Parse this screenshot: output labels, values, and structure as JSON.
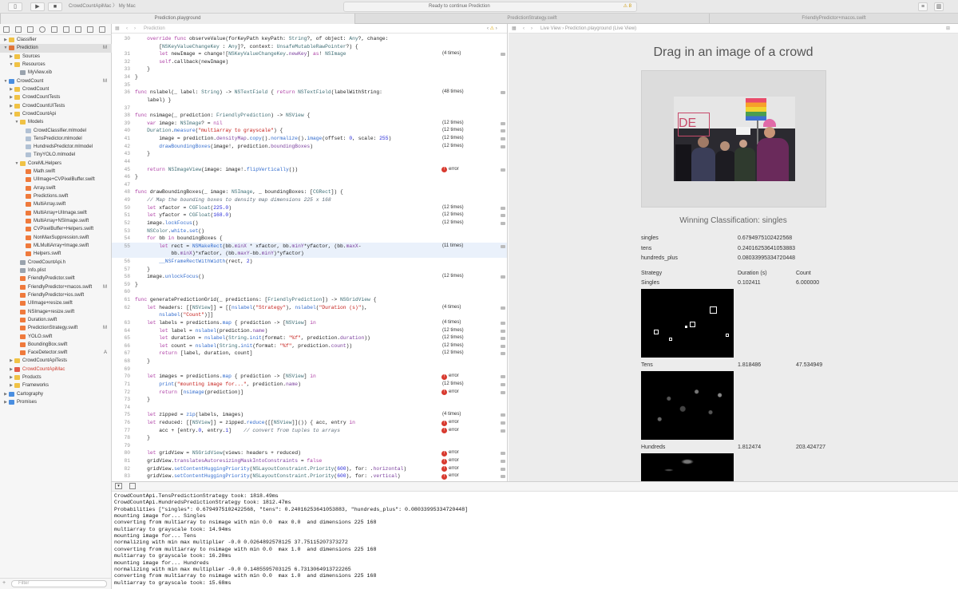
{
  "toolbar": {
    "scheme": "CrowdCountApiMac",
    "destination": "My Mac",
    "status": "Ready to continue Prediction",
    "warnings": "8"
  },
  "tabs": [
    "Prediction.playground",
    "PredictionStrategy.swift",
    "FriendlyPredictor+macos.swift"
  ],
  "navigator": {
    "filter_placeholder": "Filter",
    "items": [
      {
        "label": "Classifier",
        "depth": 0,
        "kind": "folder",
        "open": false,
        "badge": ""
      },
      {
        "label": "Prediction",
        "depth": 0,
        "kind": "playground",
        "open": true,
        "badge": "M",
        "selected": true
      },
      {
        "label": "Sources",
        "depth": 1,
        "kind": "folder",
        "open": false,
        "badge": ""
      },
      {
        "label": "Resources",
        "depth": 1,
        "kind": "folder",
        "open": true,
        "badge": ""
      },
      {
        "label": "MyView.xib",
        "depth": 2,
        "kind": "file",
        "open": null,
        "badge": ""
      },
      {
        "label": "CrowdCount",
        "depth": 0,
        "kind": "project",
        "open": true,
        "badge": "M"
      },
      {
        "label": "CrowdCount",
        "depth": 1,
        "kind": "folder",
        "open": false,
        "badge": ""
      },
      {
        "label": "CrowdCountTests",
        "depth": 1,
        "kind": "folder",
        "open": false,
        "badge": ""
      },
      {
        "label": "CrowdCountUITests",
        "depth": 1,
        "kind": "folder",
        "open": false,
        "badge": ""
      },
      {
        "label": "CrowdCountApi",
        "depth": 1,
        "kind": "folder",
        "open": true,
        "badge": ""
      },
      {
        "label": "Models",
        "depth": 2,
        "kind": "folder",
        "open": true,
        "badge": ""
      },
      {
        "label": "CrowdClassifier.mlmodel",
        "depth": 3,
        "kind": "model",
        "open": null,
        "badge": ""
      },
      {
        "label": "TensPredictor.mlmodel",
        "depth": 3,
        "kind": "model",
        "open": null,
        "badge": ""
      },
      {
        "label": "HundredsPredictor.mlmodel",
        "depth": 3,
        "kind": "model",
        "open": null,
        "badge": ""
      },
      {
        "label": "TinyYOLO.mlmodel",
        "depth": 3,
        "kind": "model",
        "open": null,
        "badge": ""
      },
      {
        "label": "CoreMLHelpers",
        "depth": 2,
        "kind": "folder",
        "open": true,
        "badge": ""
      },
      {
        "label": "Math.swift",
        "depth": 3,
        "kind": "swift",
        "open": null,
        "badge": ""
      },
      {
        "label": "UIImage+CVPixelBuffer.swift",
        "depth": 3,
        "kind": "swift",
        "open": null,
        "badge": ""
      },
      {
        "label": "Array.swift",
        "depth": 3,
        "kind": "swift",
        "open": null,
        "badge": ""
      },
      {
        "label": "Predictions.swift",
        "depth": 3,
        "kind": "swift",
        "open": null,
        "badge": ""
      },
      {
        "label": "MultiArray.swift",
        "depth": 3,
        "kind": "swift",
        "open": null,
        "badge": ""
      },
      {
        "label": "MultiArray+UIImage.swift",
        "depth": 3,
        "kind": "swift",
        "open": null,
        "badge": ""
      },
      {
        "label": "MultiArray+NSImage.swift",
        "depth": 3,
        "kind": "swift",
        "open": null,
        "badge": ""
      },
      {
        "label": "CVPixelBuffer+Helpers.swift",
        "depth": 3,
        "kind": "swift",
        "open": null,
        "badge": ""
      },
      {
        "label": "NonMaxSuppression.swift",
        "depth": 3,
        "kind": "swift",
        "open": null,
        "badge": ""
      },
      {
        "label": "MLMultiArray+Image.swift",
        "depth": 3,
        "kind": "swift",
        "open": null,
        "badge": ""
      },
      {
        "label": "Helpers.swift",
        "depth": 3,
        "kind": "swift",
        "open": null,
        "badge": ""
      },
      {
        "label": "CrowdCountApi.h",
        "depth": 2,
        "kind": "header",
        "open": null,
        "badge": ""
      },
      {
        "label": "Info.plist",
        "depth": 2,
        "kind": "plist",
        "open": null,
        "badge": ""
      },
      {
        "label": "FriendlyPredictor.swift",
        "depth": 2,
        "kind": "swift",
        "open": null,
        "badge": ""
      },
      {
        "label": "FriendlyPredictor+macos.swift",
        "depth": 2,
        "kind": "swift",
        "open": null,
        "badge": "M"
      },
      {
        "label": "FriendlyPredictor+ios.swift",
        "depth": 2,
        "kind": "swift",
        "open": null,
        "badge": ""
      },
      {
        "label": "UIImage+resize.swift",
        "depth": 2,
        "kind": "swift",
        "open": null,
        "badge": ""
      },
      {
        "label": "NSImage+resize.swift",
        "depth": 2,
        "kind": "swift",
        "open": null,
        "badge": ""
      },
      {
        "label": "Duration.swift",
        "depth": 2,
        "kind": "swift",
        "open": null,
        "badge": ""
      },
      {
        "label": "PredictionStrategy.swift",
        "depth": 2,
        "kind": "swift",
        "open": null,
        "badge": "M"
      },
      {
        "label": "YOLO.swift",
        "depth": 2,
        "kind": "swift",
        "open": null,
        "badge": ""
      },
      {
        "label": "BoundingBox.swift",
        "depth": 2,
        "kind": "swift",
        "open": null,
        "badge": ""
      },
      {
        "label": "FaceDetector.swift",
        "depth": 2,
        "kind": "swift",
        "open": null,
        "badge": "A"
      },
      {
        "label": "CrowdCountApiTests",
        "depth": 1,
        "kind": "folder",
        "open": false,
        "badge": ""
      },
      {
        "label": "CrowdCountApiMac",
        "depth": 1,
        "kind": "folder-red",
        "open": false,
        "badge": ""
      },
      {
        "label": "Products",
        "depth": 1,
        "kind": "folder",
        "open": false,
        "badge": ""
      },
      {
        "label": "Frameworks",
        "depth": 1,
        "kind": "folder",
        "open": false,
        "badge": ""
      },
      {
        "label": "Cartography",
        "depth": 0,
        "kind": "project",
        "open": false,
        "badge": ""
      },
      {
        "label": "Promises",
        "depth": 0,
        "kind": "project",
        "open": false,
        "badge": ""
      }
    ]
  },
  "editor": {
    "jumpbar": "Prediction",
    "lines": [
      {
        "n": "30",
        "html": "    <span class=k>override func</span> observeValue(forKeyPath keyPath: <span class=t>String</span>?, of object: <span class=t>Any</span>?, change:",
        "r": ""
      },
      {
        "n": "",
        "html": "        [<span class=t>NSKeyValueChangeKey</span> : <span class=t>Any</span>]?, context: <span class=t>UnsafeMutableRawPointer</span>?) {",
        "r": ""
      },
      {
        "n": "31",
        "html": "        <span class=k>let</span> newImage = change![<span class=t>NSKeyValueChangeKey</span>.<span class=p>newKey</span>] <span class=k>as</span>! <span class=t>NSImage</span>",
        "r": "(4 times)"
      },
      {
        "n": "32",
        "html": "        <span class=k>self</span>.callback(newImage)",
        "r": ""
      },
      {
        "n": "33",
        "html": "    }",
        "r": ""
      },
      {
        "n": "34",
        "html": "}",
        "r": ""
      },
      {
        "n": "35",
        "html": "",
        "r": ""
      },
      {
        "n": "36",
        "html": "<span class=k>func</span> nslabel(_ label: <span class=t>String</span>) -> <span class=t>NSTextField</span> { <span class=k>return</span> <span class=t>NSTextField</span>(labelWithString:",
        "r": "(48 times)"
      },
      {
        "n": "",
        "html": "    label) }",
        "r": ""
      },
      {
        "n": "37",
        "html": "",
        "r": ""
      },
      {
        "n": "38",
        "html": "<span class=k>func</span> nsimage(_ prediction: <span class=t>FriendlyPrediction</span>) -> <span class=t>NSView</span> {",
        "r": ""
      },
      {
        "n": "39",
        "html": "    <span class=k>var</span> image: <span class=t>NSImage</span>? = <span class=k>nil</span>",
        "r": "(12 times)"
      },
      {
        "n": "40",
        "html": "    <span class=t>Duration</span>.<span class=f>measure</span>(<span class=s>\"multiarray to grayscale\"</span>) {",
        "r": "(12 times)"
      },
      {
        "n": "41",
        "html": "        image = prediction.<span class=p>densityMap</span>.<span class=f>copy</span>().<span class=f>normalize</span>().<span class=f>image</span>(offset: <span class=n>0</span>, scale: <span class=n>255</span>)",
        "r": "(12 times)"
      },
      {
        "n": "42",
        "html": "        <span class=f>drawBoundingBoxes</span>(image!, prediction.<span class=p>boundingBoxes</span>)",
        "r": "(12 times)"
      },
      {
        "n": "43",
        "html": "    }",
        "r": ""
      },
      {
        "n": "44",
        "html": "",
        "r": ""
      },
      {
        "n": "45",
        "html": "    <span class=k>return</span> <span class=t>NSImageView</span>(image: image!.<span class=f>flipVertically</span>())",
        "r": "error",
        "err": true
      },
      {
        "n": "46",
        "html": "}",
        "r": ""
      },
      {
        "n": "47",
        "html": "",
        "r": ""
      },
      {
        "n": "48",
        "html": "<span class=k>func</span> drawBoundingBoxes(_ image: <span class=t>NSImage</span>, _ boundingBoxes: [<span class=t>CGRect</span>]) {",
        "r": ""
      },
      {
        "n": "49",
        "html": "    <span class=c>// Map the bounding boxes to density map dimensions 225 x 168</span>",
        "r": ""
      },
      {
        "n": "50",
        "html": "    <span class=k>let</span> xfactor = <span class=t>CGFloat</span>(<span class=n>225.0</span>)",
        "r": "(12 times)"
      },
      {
        "n": "51",
        "html": "    <span class=k>let</span> yfactor = <span class=t>CGFloat</span>(<span class=n>168.0</span>)",
        "r": "(12 times)"
      },
      {
        "n": "52",
        "html": "    image.<span class=f>lockFocus</span>()",
        "r": "(12 times)"
      },
      {
        "n": "53",
        "html": "    <span class=t>NSColor</span>.<span class=f>white</span>.<span class=f>set</span>()",
        "r": ""
      },
      {
        "n": "54",
        "html": "    <span class=k>for</span> bb <span class=k>in</span> boundingBoxes {",
        "r": ""
      },
      {
        "n": "55",
        "html": "        <span class=k>let</span> rect = <span class=f>NSMakeRect</span>(bb.<span class=p>minX</span> * xfactor, bb.<span class=p>minY</span>*yfactor, (bb.<span class=p>maxX</span>-",
        "r": "(11 times)",
        "hl": true
      },
      {
        "n": "",
        "html": "            bb.<span class=p>minX</span>)*xfactor, (bb.<span class=p>maxY</span>-bb.<span class=p>minY</span>)*yfactor)",
        "r": "",
        "hl": true
      },
      {
        "n": "56",
        "html": "        <span class=f>__NSFrameRectWithWidth</span>(rect, <span class=n>2</span>)",
        "r": ""
      },
      {
        "n": "57",
        "html": "    }",
        "r": ""
      },
      {
        "n": "58",
        "html": "    image.<span class=f>unlockFocus</span>()",
        "r": "(12 times)"
      },
      {
        "n": "59",
        "html": "}",
        "r": ""
      },
      {
        "n": "60",
        "html": "",
        "r": ""
      },
      {
        "n": "61",
        "html": "<span class=k>func</span> generatePredictionGrid(_ predictions: [<span class=t>FriendlyPrediction</span>]) -> <span class=t>NSGridView</span> {",
        "r": ""
      },
      {
        "n": "62",
        "html": "    <span class=k>let</span> headers: [[<span class=t>NSView</span>]] = [[<span class=f>nslabel</span>(<span class=s>\"Strategy\"</span>), <span class=f>nslabel</span>(<span class=s>\"Duration (s)\"</span>),",
        "r": "(4 times)"
      },
      {
        "n": "",
        "html": "        <span class=f>nslabel</span>(<span class=s>\"Count\"</span>)]]",
        "r": ""
      },
      {
        "n": "63",
        "html": "    <span class=k>let</span> labels = predictions.<span class=f>map</span> { prediction -> [<span class=t>NSView</span>] <span class=k>in</span>",
        "r": "(4 times)"
      },
      {
        "n": "64",
        "html": "        <span class=k>let</span> label = <span class=f>nslabel</span>(prediction.<span class=p>name</span>)",
        "r": "(12 times)"
      },
      {
        "n": "65",
        "html": "        <span class=k>let</span> duration = <span class=f>nslabel</span>(<span class=t>String</span>.<span class=f>init</span>(format: <span class=s>\"%f\"</span>, prediction.<span class=p>duration</span>))",
        "r": "(12 times)"
      },
      {
        "n": "66",
        "html": "        <span class=k>let</span> count = <span class=f>nslabel</span>(<span class=t>String</span>.<span class=f>init</span>(format: <span class=s>\"%f\"</span>, prediction.<span class=p>count</span>))",
        "r": "(12 times)"
      },
      {
        "n": "67",
        "html": "        <span class=k>return</span> [label, duration, count]",
        "r": "(12 times)"
      },
      {
        "n": "68",
        "html": "    }",
        "r": ""
      },
      {
        "n": "69",
        "html": "",
        "r": ""
      },
      {
        "n": "70",
        "html": "    <span class=k>let</span> images = predictions.<span class=f>map</span> { prediction -> [<span class=t>NSView</span>] <span class=k>in</span>",
        "r": "error",
        "err": true
      },
      {
        "n": "71",
        "html": "        <span class=f>print</span>(<span class=s>\"mounting image for...\"</span>, prediction.<span class=p>name</span>)",
        "r": "(12 times)"
      },
      {
        "n": "72",
        "html": "        <span class=k>return</span> [<span class=f>nsimage</span>(prediction)]",
        "r": "error",
        "err": true
      },
      {
        "n": "73",
        "html": "    }",
        "r": ""
      },
      {
        "n": "74",
        "html": "",
        "r": ""
      },
      {
        "n": "75",
        "html": "    <span class=k>let</span> zipped = <span class=f>zip</span>(labels, images)",
        "r": "(4 times)"
      },
      {
        "n": "76",
        "html": "    <span class=k>let</span> reduced: [[<span class=t>NSView</span>]] = zipped.<span class=f>reduce</span>([[<span class=t>NSView</span>]]()) { acc, entry <span class=k>in</span>",
        "r": "error",
        "err": true
      },
      {
        "n": "77",
        "html": "        acc + [entry.<span class=n>0</span>, entry.<span class=n>1</span>]    <span class=c>// convert from tuples to arrays</span>",
        "r": "error",
        "err": true
      },
      {
        "n": "78",
        "html": "    }",
        "r": ""
      },
      {
        "n": "79",
        "html": "",
        "r": ""
      },
      {
        "n": "80",
        "html": "    <span class=k>let</span> gridView = <span class=t>NSGridView</span>(views: headers + reduced)",
        "r": "error",
        "err": true
      },
      {
        "n": "81",
        "html": "    gridView.<span class=p>translatesAutoresizingMaskIntoConstraints</span> = <span class=k>false</span>",
        "r": "error",
        "err": true
      },
      {
        "n": "82",
        "html": "    gridView.<span class=f>setContentHuggingPriority</span>(<span class=t>NSLayoutConstraint</span>.<span class=t>Priority</span>(<span class=n>600</span>), for: .<span class=p>horizontal</span>)",
        "r": "error",
        "err": true
      },
      {
        "n": "83",
        "html": "    gridView.<span class=f>setContentHuggingPriority</span>(<span class=t>NSLayoutConstraint</span>.<span class=t>Priority</span>(<span class=n>600</span>), for: .<span class=p>vertical</span>)",
        "r": "error",
        "err": true
      },
      {
        "n": "84",
        "html": "",
        "r": ""
      }
    ]
  },
  "liveview": {
    "jumpbar": "Live View  ›  Prediction.playground (Live View)",
    "title": "Drag in an image of a crowd",
    "win_title": "Winning Classification: singles",
    "probabilities": [
      {
        "label": "singles",
        "value": "0.6794975102422568"
      },
      {
        "label": "tens",
        "value": "0.24016253641053883"
      },
      {
        "label": "hundreds_plus",
        "value": "0.08033995334720448"
      }
    ],
    "headers": [
      "Strategy",
      "Duration (s)",
      "Count"
    ],
    "rows": [
      {
        "strategy": "Singles",
        "duration": "0.102411",
        "count": "6.000000"
      },
      {
        "strategy": "Tens",
        "duration": "1.818486",
        "count": "47.534949"
      },
      {
        "strategy": "Hundreds",
        "duration": "1.812474",
        "count": "203.424727"
      }
    ]
  },
  "console": {
    "lines": [
      "CrowdCountApi.TensPredictionStrategy took: 1818.49ms",
      "CrowdCountApi.HundredsPredictionStrategy took: 1812.47ms",
      "Probabilities [\"singles\": 0.6794975102422568, \"tens\": 0.24016253641053883, \"hundreds_plus\": 0.08033995334720448]",
      "mounting image for... Singles",
      "converting from multiarray to nsimage with min 0.0  max 0.0  and dimensions 225 168",
      "multiarray to grayscale took: 14.94ms",
      "mounting image for... Tens",
      "normalizing with min max multiplier -0.0 0.0264892578125 37.75115207373272",
      "converting from multiarray to nsimage with min 0.0  max 1.0  and dimensions 225 168",
      "multiarray to grayscale took: 16.20ms",
      "mounting image for... Hundreds",
      "normalizing with min max multiplier -0.0 0.1485595703125 6.7313064913722265",
      "converting from multiarray to nsimage with min 0.0  max 1.0  and dimensions 225 168",
      "multiarray to grayscale took: 15.68ms"
    ]
  },
  "colors": {
    "error": "#d83a2f",
    "accent": "#1a73e8",
    "selection": "#e0e0e0",
    "folder": "#f0c245"
  }
}
